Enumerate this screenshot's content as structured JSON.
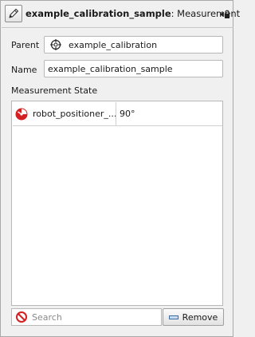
{
  "header": {
    "title_bold": "example_calibration_sample",
    "title_rest": ": Measurement",
    "edit_icon": "pencil-icon",
    "pin_icon": "pin-icon"
  },
  "form": {
    "parent_label": "Parent",
    "parent_value": "example_calibration",
    "parent_icon": "target-icon",
    "name_label": "Name",
    "name_value": "example_calibration_sample"
  },
  "measurement_state": {
    "section_label": "Measurement State",
    "rows": [
      {
        "icon": "gauge-icon",
        "name": "robot_positioner_...",
        "value": "90°"
      }
    ]
  },
  "bottom": {
    "search_placeholder": "Search",
    "search_icon": "no-entry-icon",
    "remove_label": "Remove"
  },
  "colors": {
    "accent_red": "#d32020",
    "background": "#f0f0f0"
  }
}
